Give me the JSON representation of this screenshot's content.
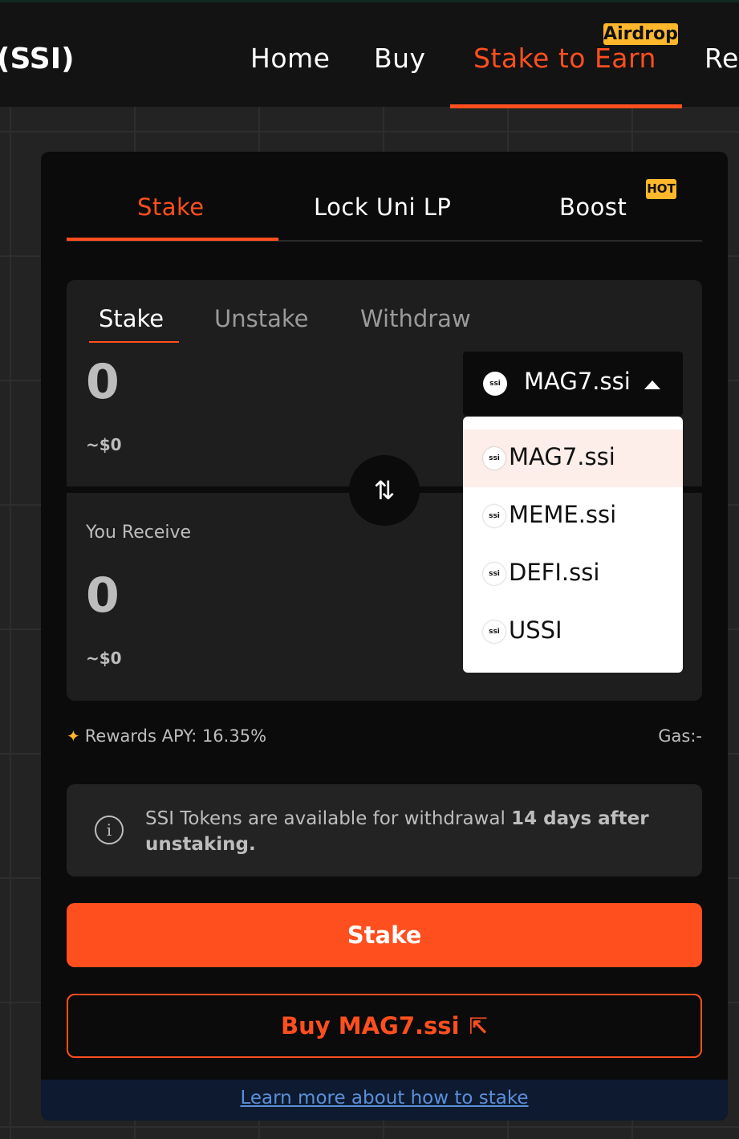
{
  "nav": {
    "brand": "(SSI)",
    "items": [
      "Home",
      "Buy",
      "Stake to Earn",
      "Re"
    ],
    "active": "Stake to Earn",
    "airdrop_badge": "Airdrop"
  },
  "card_tabs": {
    "items": [
      "Stake",
      "Lock Uni LP",
      "Boost"
    ],
    "active": "Stake",
    "hot_badge": "HOT"
  },
  "sub_tabs": {
    "items": [
      "Stake",
      "Unstake",
      "Withdraw"
    ],
    "active": "Stake"
  },
  "input": {
    "amount": "0",
    "usd": "~$0"
  },
  "output": {
    "label": "You Receive",
    "amount": "0",
    "usd": "~$0"
  },
  "token_select": {
    "selected": "MAG7.ssi",
    "logo_text": "ssi"
  },
  "dropdown": {
    "options": [
      "MAG7.ssi",
      "MEME.ssi",
      "DEFI.ssi",
      "USSI"
    ],
    "logo_text": "ssi"
  },
  "stats": {
    "apy": "Rewards APY: 16.35%",
    "gas": "Gas:-"
  },
  "notice": {
    "text": "SSI Tokens are available for withdrawal ",
    "bold": "14 days after unstaking."
  },
  "actions": {
    "stake": "Stake",
    "buy": "Buy MAG7.ssi",
    "learn": "Learn more about how to stake"
  },
  "colors": {
    "accent": "#ff4f1f",
    "badge": "#ffb72c",
    "background": "#232323",
    "card": "#0b0b0b"
  }
}
